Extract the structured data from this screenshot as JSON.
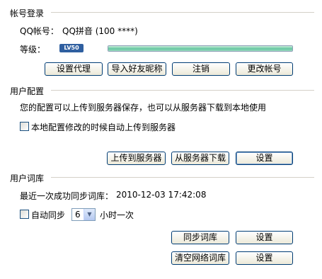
{
  "account": {
    "section_title": "帐号登录",
    "qq_label": "QQ帐号：",
    "qq_value": "QQ拼音 (100 ****)",
    "level_label": "等级：",
    "level_badge": "LV50",
    "level_progress": 1.0,
    "buttons": {
      "set_proxy": "设置代理",
      "import_nicknames": "导入好友昵称",
      "logout": "注销",
      "change_account": "更改帐号"
    }
  },
  "user_config": {
    "section_title": "用户配置",
    "description": "您的配置可以上传到服务器保存，也可以从服务器下载到本地使用",
    "auto_upload_label": "本地配置修改的时候自动上传到服务器",
    "auto_upload_checked": false,
    "buttons": {
      "upload": "上传到服务器",
      "download": "从服务器下载",
      "settings": "设置"
    }
  },
  "user_lexicon": {
    "section_title": "用户词库",
    "last_sync_label": "最近一次成功同步词库：",
    "last_sync_value": "2010-12-03 17:42:08",
    "auto_sync_label": "自动同步",
    "auto_sync_checked": false,
    "sync_interval_value": "6",
    "sync_interval_suffix": "小时一次",
    "buttons": {
      "sync_lexicon": "同步词库",
      "sync_settings": "设置",
      "clear_network_lexicon": "清空网络词库",
      "clear_settings": "设置"
    }
  },
  "colors": {
    "section_rule": "#d4d0c8",
    "button_border": "#003c74",
    "badge_bg": "#2f5fa0",
    "progress_fill": "#64c6a0"
  }
}
